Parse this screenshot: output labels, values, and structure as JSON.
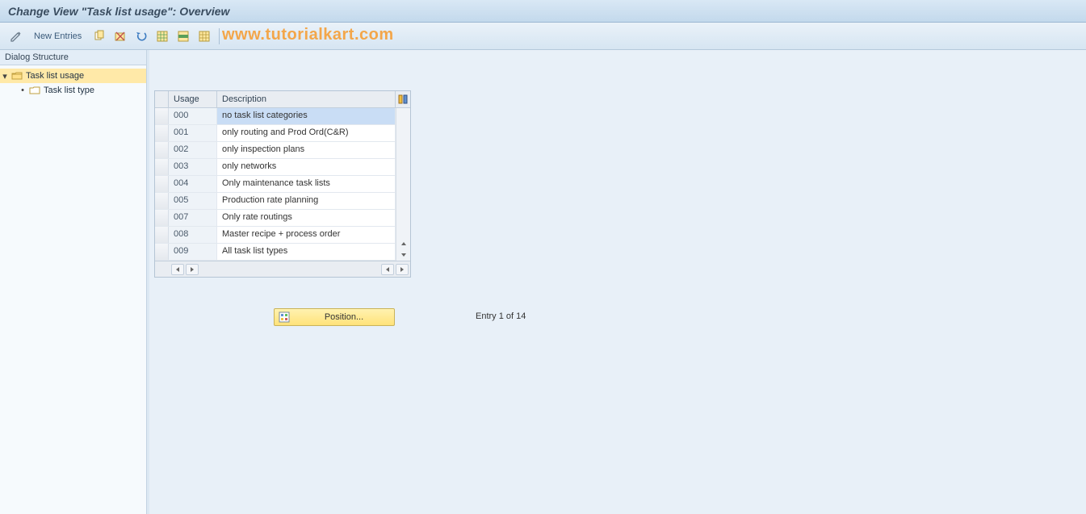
{
  "title": "Change View \"Task list usage\": Overview",
  "toolbar": {
    "new_entries_label": "New Entries"
  },
  "watermark": "www.tutorialkart.com",
  "tree": {
    "header": "Dialog Structure",
    "root_label": "Task list usage",
    "child_label": "Task list type"
  },
  "table": {
    "col_usage": "Usage",
    "col_desc": "Description",
    "rows": [
      {
        "usage": "000",
        "desc": "no task list categories",
        "selected": true
      },
      {
        "usage": "001",
        "desc": "only routing and Prod Ord(C&R)"
      },
      {
        "usage": "002",
        "desc": "only inspection plans"
      },
      {
        "usage": "003",
        "desc": "only networks"
      },
      {
        "usage": "004",
        "desc": "Only maintenance task lists"
      },
      {
        "usage": "005",
        "desc": "Production rate planning"
      },
      {
        "usage": "007",
        "desc": "Only rate routings"
      },
      {
        "usage": "008",
        "desc": "Master recipe + process order"
      },
      {
        "usage": "009",
        "desc": "All task list types"
      }
    ]
  },
  "position_button_label": "Position...",
  "entry_counter": "Entry 1 of 14"
}
